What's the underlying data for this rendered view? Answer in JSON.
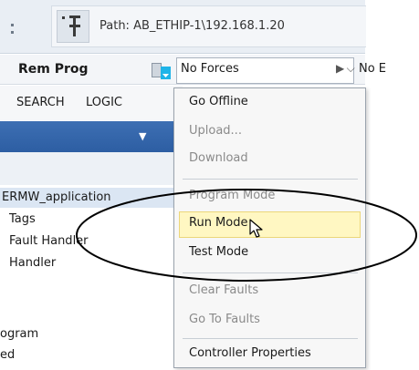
{
  "toolbar": {
    "path_label": "Path: AB_ETHIP-1\\192.168.1.20"
  },
  "status": {
    "mode": "Rem Prog",
    "forces": "No Forces",
    "truncated_next": "No E"
  },
  "tabs": [
    "SEARCH",
    "LOGIC"
  ],
  "tree": [
    "ERMW_application",
    "Tags",
    "Fault Handler",
    "Handler",
    "ogram",
    "ed"
  ],
  "menu": {
    "items": [
      {
        "label": "Go Offline",
        "enabled": true
      },
      {
        "label": "Upload...",
        "enabled": false
      },
      {
        "label": "Download",
        "enabled": false
      },
      {
        "label": "Program Mode",
        "enabled": false
      },
      {
        "label": "Run Mode",
        "enabled": true,
        "highlighted": true
      },
      {
        "label": "Test Mode",
        "enabled": true
      },
      {
        "label": "Clear Faults",
        "enabled": false
      },
      {
        "label": "Go To Faults",
        "enabled": false
      },
      {
        "label": "Controller Properties",
        "enabled": true
      }
    ]
  },
  "colors": {
    "accent_blue": "#2d5ea3",
    "highlight": "#fff7c2",
    "mode_arrow": "#1fb4e8"
  },
  "icons": {
    "path_icon": "controller-path-icon",
    "cursor": "mouse-pointer-icon"
  }
}
